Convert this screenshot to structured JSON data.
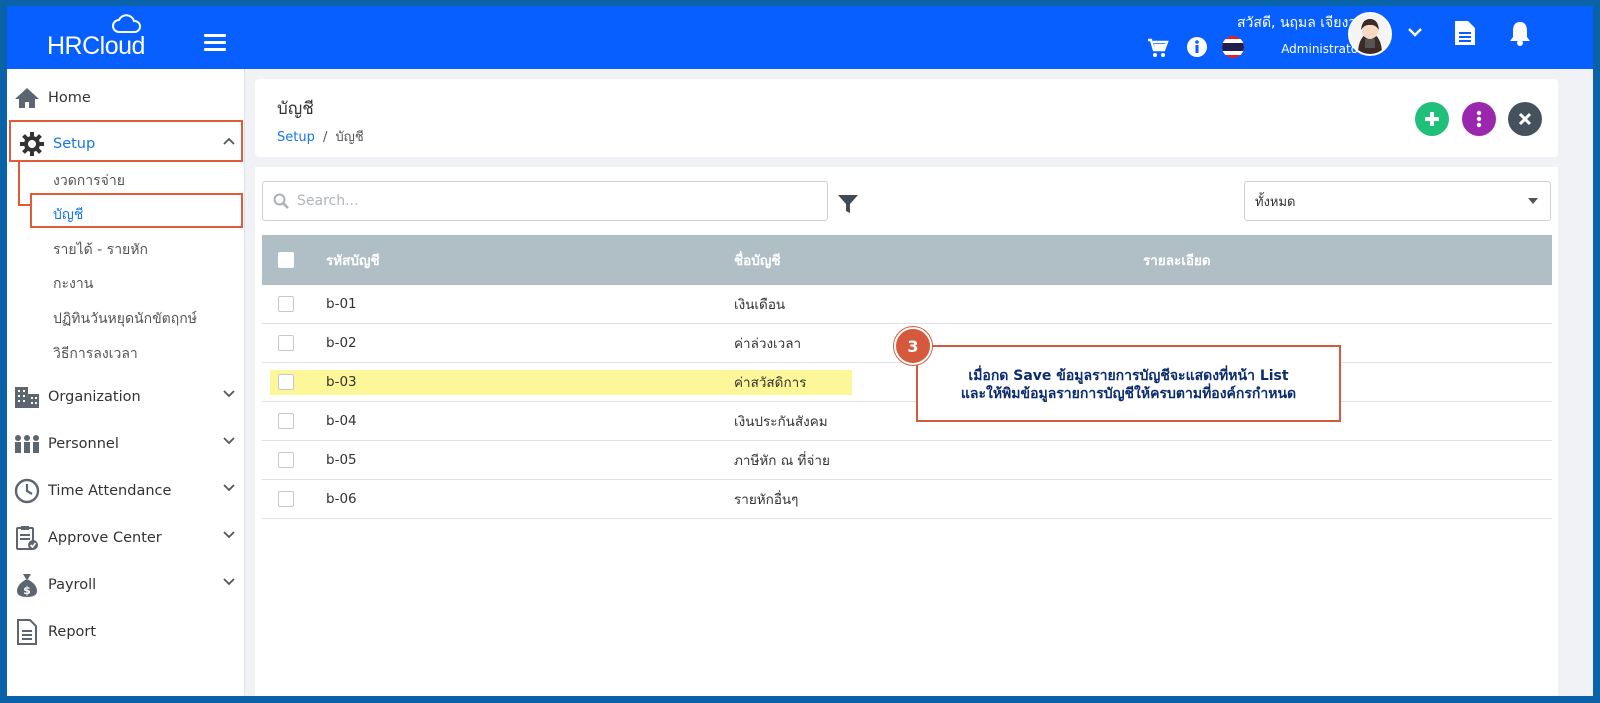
{
  "topbar": {
    "logo_text": "HRCloud",
    "greeting": "สวัสดี, นฤมล เจียงวง",
    "role": "Administrator"
  },
  "sidebar": {
    "items": [
      {
        "label": "Home",
        "icon": "home-icon"
      },
      {
        "label": "Setup",
        "icon": "gear-icon"
      },
      {
        "label": "Organization",
        "icon": "building-icon"
      },
      {
        "label": "Personnel",
        "icon": "people-icon"
      },
      {
        "label": "Time Attendance",
        "icon": "clock-icon"
      },
      {
        "label": "Approve Center",
        "icon": "clipboard-check-icon"
      },
      {
        "label": "Payroll",
        "icon": "money-bag-icon"
      },
      {
        "label": "Report",
        "icon": "document-icon"
      }
    ],
    "setup_sub": [
      "งวดการจ่าย",
      "บัญชี",
      "รายได้ - รายหัก",
      "กะงาน",
      "ปฏิทินวันหยุดนักขัตฤกษ์",
      "วิธีการลงเวลา"
    ]
  },
  "header": {
    "title": "บัญชี",
    "breadcrumb_root": "Setup",
    "breadcrumb_sep": "/",
    "breadcrumb_current": "บัญชี"
  },
  "filters": {
    "search_placeholder": "Search...",
    "select_value": "ทั้งหมด"
  },
  "table": {
    "columns": [
      "รหัสบัญชี",
      "ชื่อบัญชี",
      "รายละเอียด"
    ],
    "rows": [
      {
        "code": "b-01",
        "name": "เงินเดือน",
        "detail": ""
      },
      {
        "code": "b-02",
        "name": "ค่าล่วงเวลา",
        "detail": ""
      },
      {
        "code": "b-03",
        "name": "ค่าสวัสดิการ",
        "detail": ""
      },
      {
        "code": "b-04",
        "name": "เงินประกันสังคม",
        "detail": ""
      },
      {
        "code": "b-05",
        "name": "ภาษีหัก ณ ที่จ่าย",
        "detail": ""
      },
      {
        "code": "b-06",
        "name": "รายหักอื่นๆ",
        "detail": ""
      }
    ]
  },
  "callout": {
    "number": "3",
    "line1": "เมื่อกด Save ข้อมูลรายการบัญชีจะแสดงที่หน้า List",
    "line2": "และให้พิมข้อมูลรายการบัญชีให้ครบตามที่องค์กรกำหนด"
  },
  "colors": {
    "topbar": "#075fff",
    "accent_highlight": "#e15b37",
    "add_button": "#20c07a",
    "more_button": "#9b27af",
    "close_button": "#45525d",
    "table_header": "#b0bec5",
    "row_highlight": "#fdf79a"
  }
}
